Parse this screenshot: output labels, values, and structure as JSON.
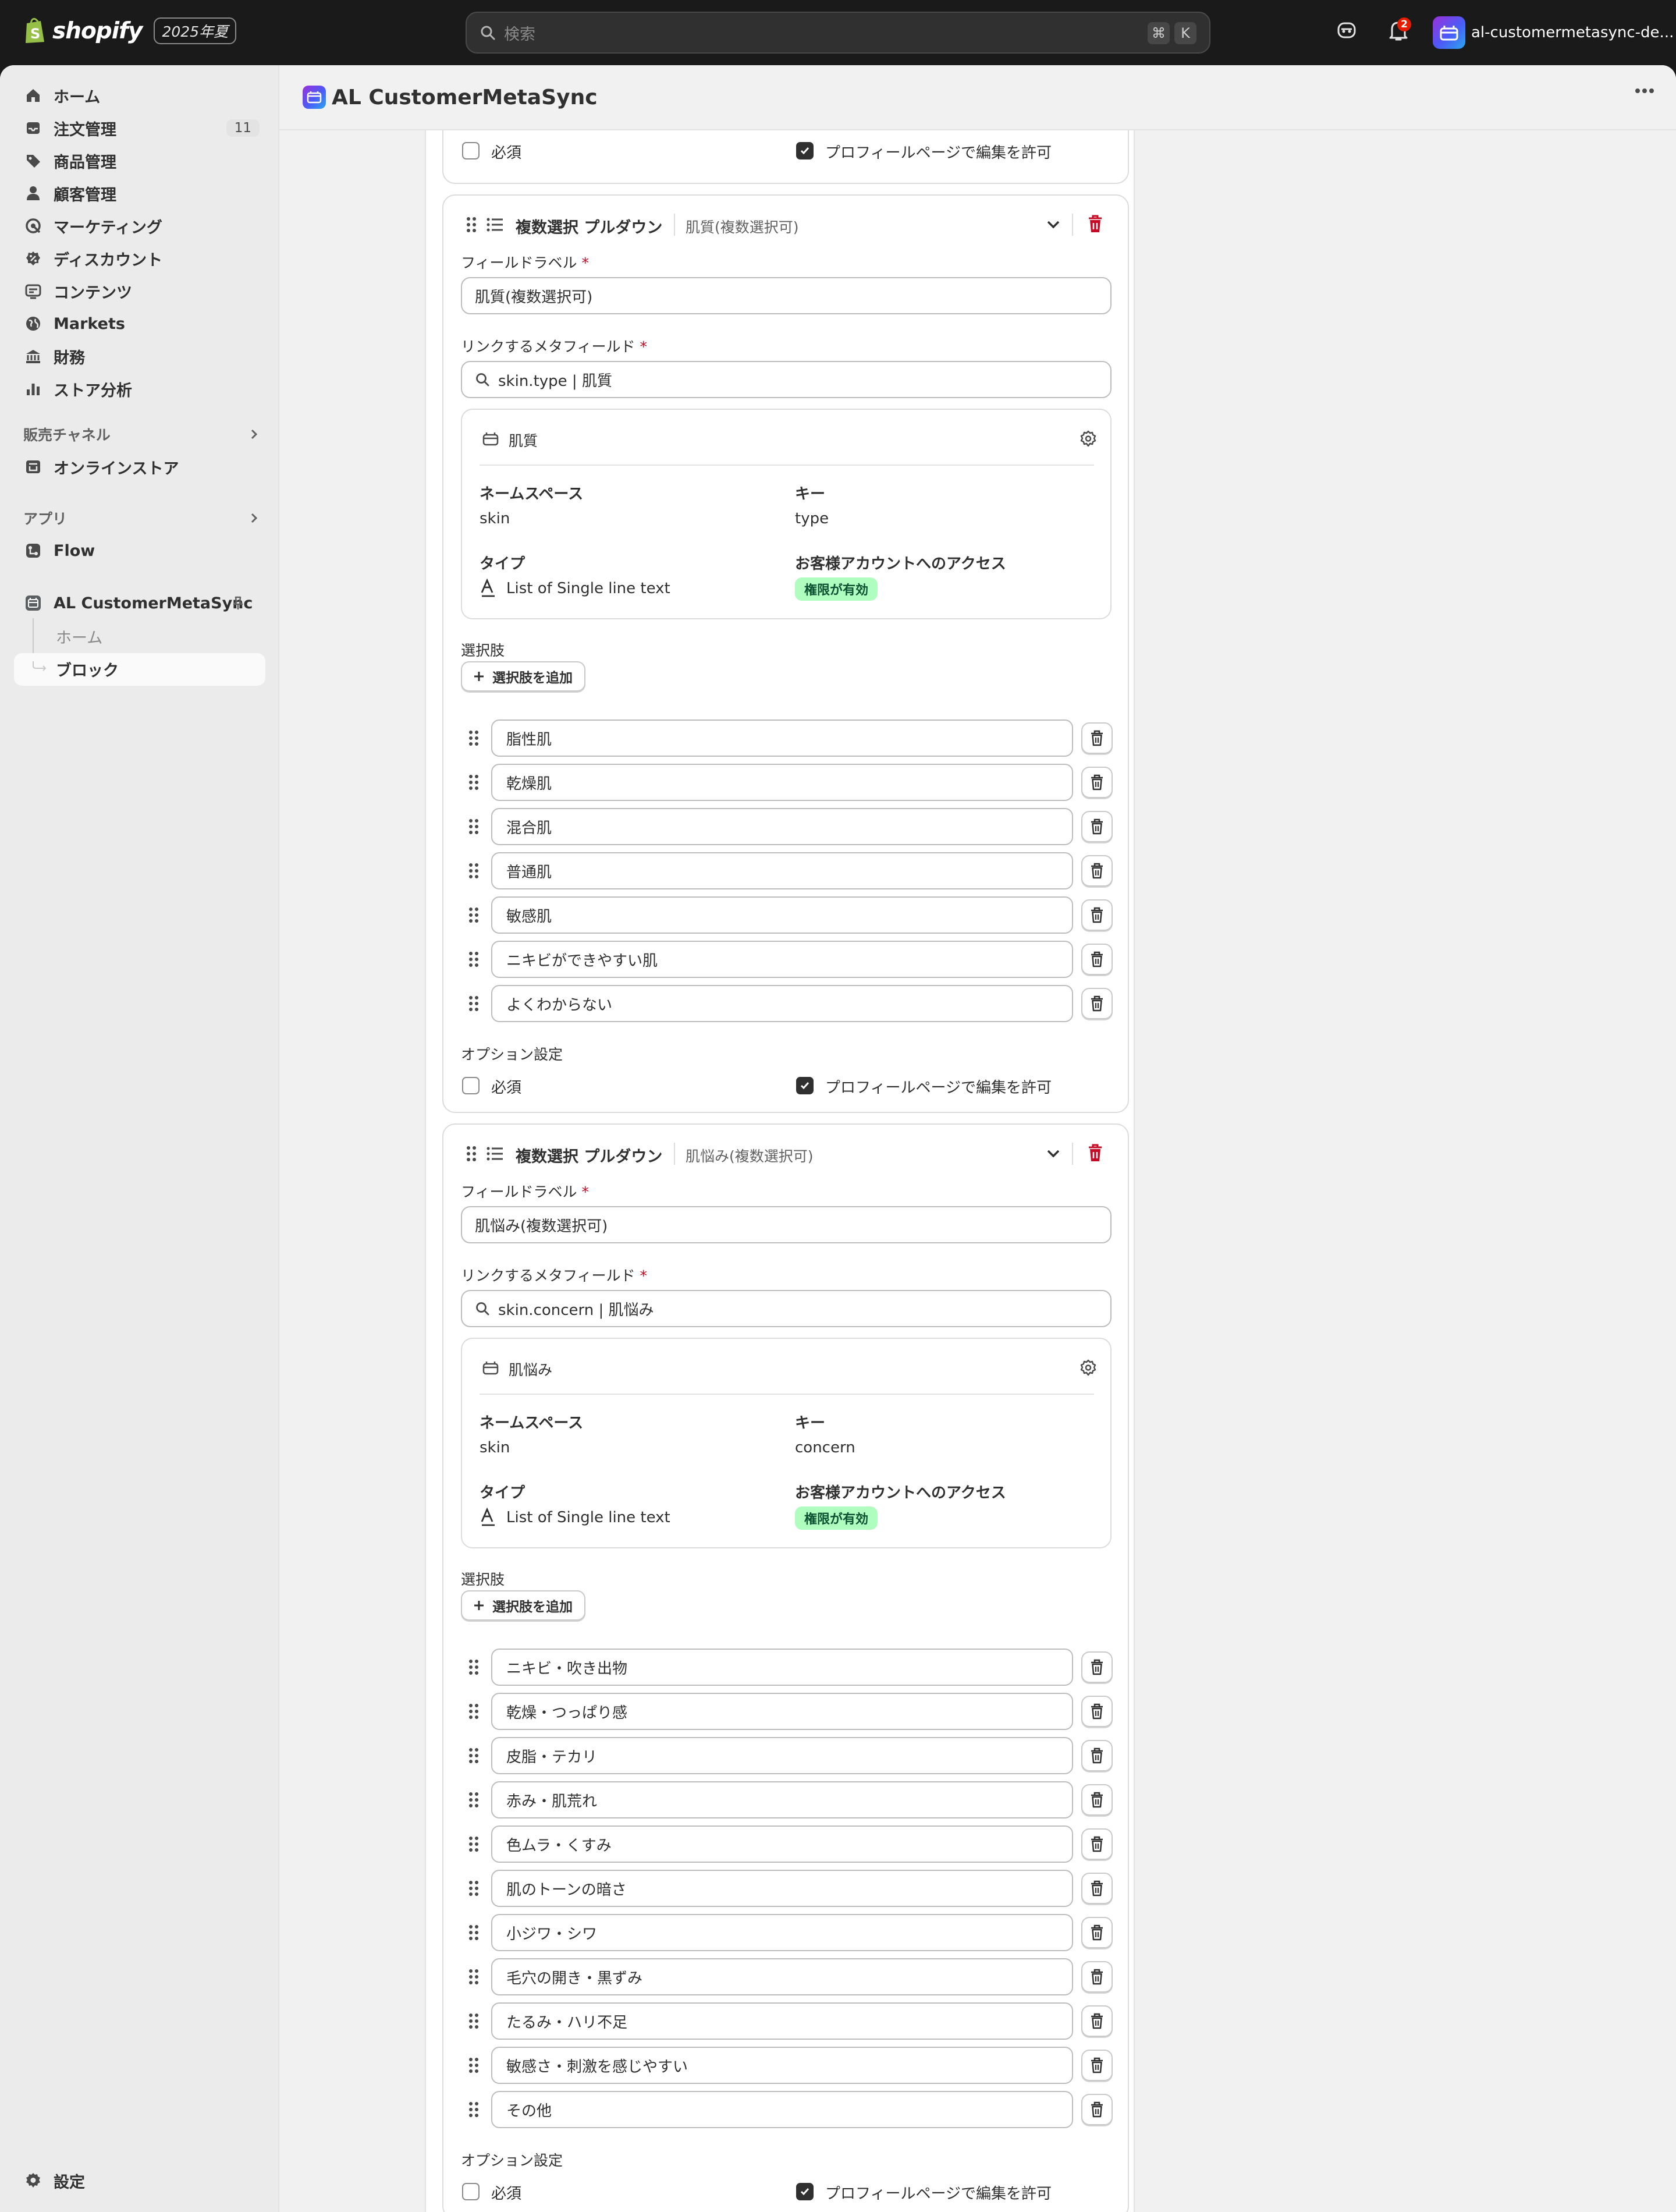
{
  "topbar": {
    "logo": "shopify",
    "edition": "2025年夏",
    "search_placeholder": "検索",
    "shortcut_cmd": "⌘",
    "shortcut_key": "K",
    "notification_count": "2",
    "store_name": "al-customermetasync-de..."
  },
  "sidebar": {
    "items": [
      {
        "label": "ホーム",
        "icon": "home-icon"
      },
      {
        "label": "注文管理",
        "icon": "inbox-icon",
        "badge": "11"
      },
      {
        "label": "商品管理",
        "icon": "tag-icon"
      },
      {
        "label": "顧客管理",
        "icon": "person-icon"
      },
      {
        "label": "マーケティング",
        "icon": "target-icon"
      },
      {
        "label": "ディスカウント",
        "icon": "discount-icon"
      },
      {
        "label": "コンテンツ",
        "icon": "content-icon"
      },
      {
        "label": "Markets",
        "icon": "globe-icon"
      },
      {
        "label": "財務",
        "icon": "bank-icon"
      },
      {
        "label": "ストア分析",
        "icon": "chart-icon"
      }
    ],
    "sales_channels_heading": "販売チャネル",
    "online_store": "オンラインストア",
    "apps_heading": "アプリ",
    "flow": "Flow",
    "app_name": "AL CustomerMetaSync",
    "app_sub_home": "ホーム",
    "app_sub_blocks": "ブロック",
    "settings": "設定"
  },
  "app_header": {
    "title": "AL CustomerMetaSync"
  },
  "common": {
    "required": "必須",
    "allow_edit": "プロフィールページで編集を許可",
    "block_type": "複数選択 プルダウン",
    "field_label": "フィールドラベル",
    "linked_metafield": "リンクするメタフィールド",
    "namespace": "ネームスペース",
    "key": "キー",
    "type": "タイプ",
    "access": "お客様アカウントへのアクセス",
    "access_badge": "権限が有効",
    "choices": "選択肢",
    "add_choice": "選択肢を追加",
    "option_settings": "オプション設定",
    "type_value": "List of Single line text"
  },
  "blocks": [
    {
      "subtitle": "肌質(複数選択可)",
      "label_value": "肌質(複数選択可)",
      "metafield_value": "skin.type | 肌質",
      "meta_name": "肌質",
      "namespace_value": "skin",
      "key_value": "type",
      "choices": [
        "脂性肌",
        "乾燥肌",
        "混合肌",
        "普通肌",
        "敏感肌",
        "ニキビができやすい肌",
        "よくわからない"
      ],
      "required_checked": false,
      "allow_edit_checked": true
    },
    {
      "subtitle": "肌悩み(複数選択可)",
      "label_value": "肌悩み(複数選択可)",
      "metafield_value": "skin.concern | 肌悩み",
      "meta_name": "肌悩み",
      "namespace_value": "skin",
      "key_value": "concern",
      "choices": [
        "ニキビ・吹き出物",
        "乾燥・つっぱり感",
        "皮脂・テカリ",
        "赤み・肌荒れ",
        "色ムラ・くすみ",
        "肌のトーンの暗さ",
        "小ジワ・シワ",
        "毛穴の開き・黒ずみ",
        "たるみ・ハリ不足",
        "敏感さ・刺激を感じやすい",
        "その他"
      ],
      "required_checked": false,
      "allow_edit_checked": true
    }
  ]
}
